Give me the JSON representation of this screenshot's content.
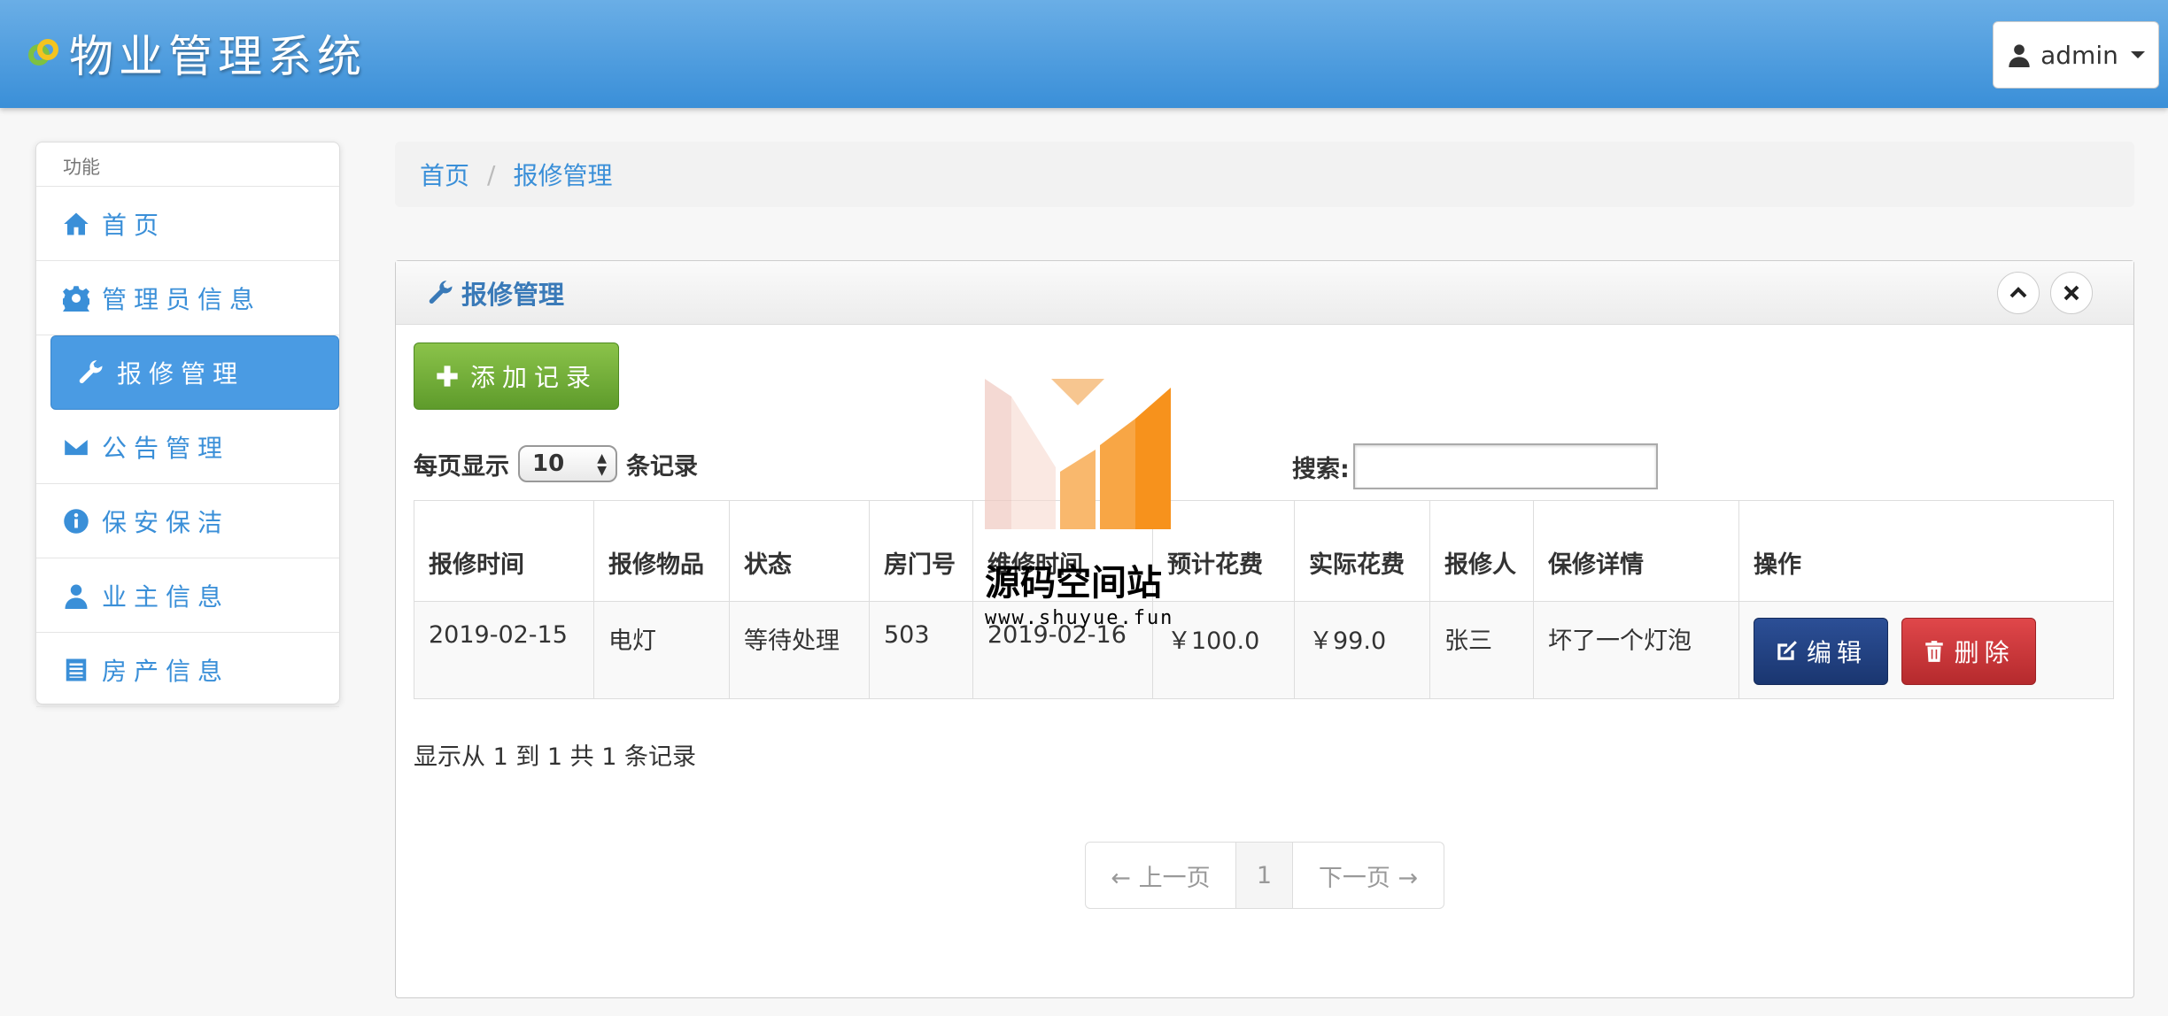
{
  "header": {
    "title": "物业管理系统",
    "user": "admin"
  },
  "sidebar": {
    "heading": "功能",
    "items": [
      {
        "label": "首页",
        "icon": "home-icon"
      },
      {
        "label": "管理员信息",
        "icon": "gear-icon"
      },
      {
        "label": "报修管理",
        "icon": "wrench-icon",
        "active": true
      },
      {
        "label": "公告管理",
        "icon": "envelope-icon"
      },
      {
        "label": "保安保洁",
        "icon": "info-icon"
      },
      {
        "label": "业主信息",
        "icon": "user-icon"
      },
      {
        "label": "房产信息",
        "icon": "list-icon"
      }
    ]
  },
  "breadcrumb": {
    "home": "首页",
    "current": "报修管理"
  },
  "box": {
    "title": "报修管理",
    "add_label": "添加记录",
    "length_prefix": "每页显示",
    "length_value": "10",
    "length_suffix": "条记录",
    "search_label": "搜索:",
    "columns": [
      "报修时间",
      "报修物品",
      "状态",
      "房门号",
      "维修时间",
      "预计花费",
      "实际花费",
      "报修人",
      "保修详情",
      "操作"
    ],
    "rows": [
      [
        "2019-02-15",
        "电灯",
        "等待处理",
        "503",
        "2019-02-16",
        "￥100.0",
        "￥99.0",
        "张三",
        "坏了一个灯泡"
      ]
    ],
    "edit_label": "编辑",
    "delete_label": "删除",
    "info": "显示从 1 到 1 共 1 条记录",
    "pager": {
      "prev": "← 上一页",
      "page": "1",
      "next": "下一页 →"
    }
  },
  "watermark": {
    "text": "源码空间站",
    "url": "www.shuyue.fun"
  },
  "colors": {
    "header": "#3a8fd8",
    "accent": "#4a9be3",
    "add": "#6aa834",
    "edit": "#1f3d80",
    "delete": "#c93437"
  }
}
